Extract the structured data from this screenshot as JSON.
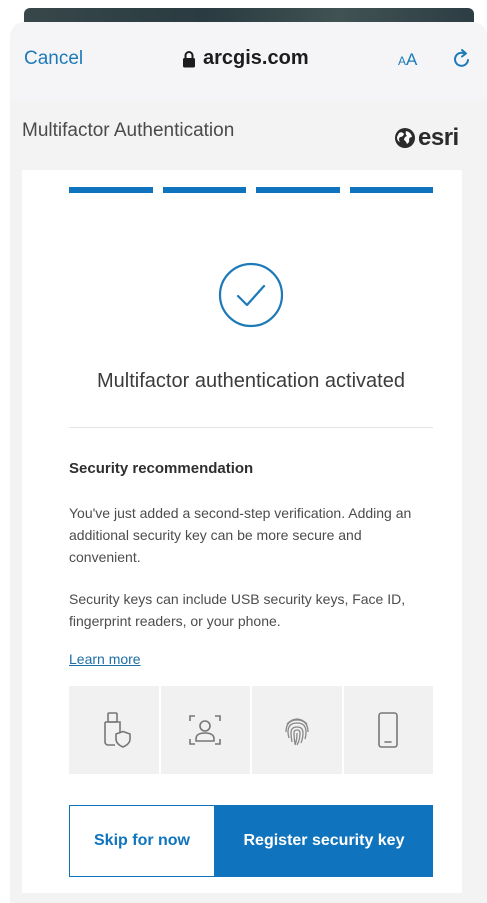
{
  "browser": {
    "cancel_label": "Cancel",
    "url": "arcgis.com",
    "text_size_label_small": "A",
    "text_size_label_large": "A",
    "lock_icon": "lock-icon",
    "reload_icon": "reload-icon"
  },
  "header": {
    "title": "Multifactor Authentication",
    "logo_text": "esri",
    "logo_icon": "globe-icon"
  },
  "progress": {
    "steps_total": 4,
    "steps_complete": 4,
    "color": "#0f74bd"
  },
  "status": {
    "icon": "checkmark-circle-icon",
    "message": "Multifactor authentication activated"
  },
  "recommendation": {
    "heading": "Security recommendation",
    "paragraph1": "You've just added a second-step verification. Adding an additional security key can be more secure and convenient.",
    "paragraph2": "Security keys can include USB security keys, Face ID, fingerprint readers, or your phone.",
    "learn_more": "Learn more",
    "key_type_icons": [
      "usb-security-key-icon",
      "face-id-icon",
      "fingerprint-icon",
      "phone-icon"
    ]
  },
  "actions": {
    "skip_label": "Skip for now",
    "register_label": "Register security key"
  },
  "colors": {
    "accent": "#0f74bd",
    "link": "#1d7ab8",
    "page_bg": "#f3f3f3"
  }
}
